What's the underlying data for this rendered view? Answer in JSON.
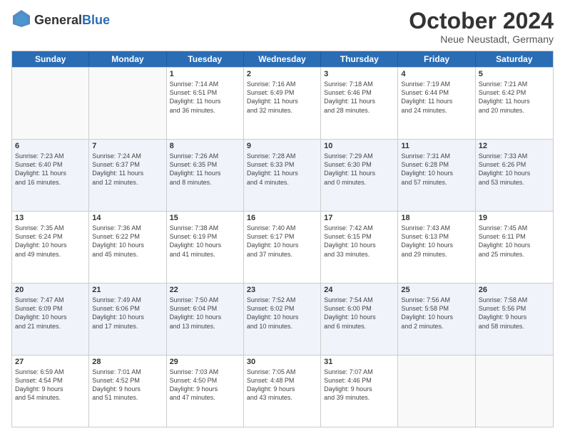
{
  "logo": {
    "general": "General",
    "blue": "Blue"
  },
  "title": "October 2024",
  "subtitle": "Neue Neustadt, Germany",
  "days": [
    "Sunday",
    "Monday",
    "Tuesday",
    "Wednesday",
    "Thursday",
    "Friday",
    "Saturday"
  ],
  "rows": [
    [
      {
        "day": "",
        "text": ""
      },
      {
        "day": "",
        "text": ""
      },
      {
        "day": "1",
        "text": "Sunrise: 7:14 AM\nSunset: 6:51 PM\nDaylight: 11 hours\nand 36 minutes."
      },
      {
        "day": "2",
        "text": "Sunrise: 7:16 AM\nSunset: 6:49 PM\nDaylight: 11 hours\nand 32 minutes."
      },
      {
        "day": "3",
        "text": "Sunrise: 7:18 AM\nSunset: 6:46 PM\nDaylight: 11 hours\nand 28 minutes."
      },
      {
        "day": "4",
        "text": "Sunrise: 7:19 AM\nSunset: 6:44 PM\nDaylight: 11 hours\nand 24 minutes."
      },
      {
        "day": "5",
        "text": "Sunrise: 7:21 AM\nSunset: 6:42 PM\nDaylight: 11 hours\nand 20 minutes."
      }
    ],
    [
      {
        "day": "6",
        "text": "Sunrise: 7:23 AM\nSunset: 6:40 PM\nDaylight: 11 hours\nand 16 minutes."
      },
      {
        "day": "7",
        "text": "Sunrise: 7:24 AM\nSunset: 6:37 PM\nDaylight: 11 hours\nand 12 minutes."
      },
      {
        "day": "8",
        "text": "Sunrise: 7:26 AM\nSunset: 6:35 PM\nDaylight: 11 hours\nand 8 minutes."
      },
      {
        "day": "9",
        "text": "Sunrise: 7:28 AM\nSunset: 6:33 PM\nDaylight: 11 hours\nand 4 minutes."
      },
      {
        "day": "10",
        "text": "Sunrise: 7:29 AM\nSunset: 6:30 PM\nDaylight: 11 hours\nand 0 minutes."
      },
      {
        "day": "11",
        "text": "Sunrise: 7:31 AM\nSunset: 6:28 PM\nDaylight: 10 hours\nand 57 minutes."
      },
      {
        "day": "12",
        "text": "Sunrise: 7:33 AM\nSunset: 6:26 PM\nDaylight: 10 hours\nand 53 minutes."
      }
    ],
    [
      {
        "day": "13",
        "text": "Sunrise: 7:35 AM\nSunset: 6:24 PM\nDaylight: 10 hours\nand 49 minutes."
      },
      {
        "day": "14",
        "text": "Sunrise: 7:36 AM\nSunset: 6:22 PM\nDaylight: 10 hours\nand 45 minutes."
      },
      {
        "day": "15",
        "text": "Sunrise: 7:38 AM\nSunset: 6:19 PM\nDaylight: 10 hours\nand 41 minutes."
      },
      {
        "day": "16",
        "text": "Sunrise: 7:40 AM\nSunset: 6:17 PM\nDaylight: 10 hours\nand 37 minutes."
      },
      {
        "day": "17",
        "text": "Sunrise: 7:42 AM\nSunset: 6:15 PM\nDaylight: 10 hours\nand 33 minutes."
      },
      {
        "day": "18",
        "text": "Sunrise: 7:43 AM\nSunset: 6:13 PM\nDaylight: 10 hours\nand 29 minutes."
      },
      {
        "day": "19",
        "text": "Sunrise: 7:45 AM\nSunset: 6:11 PM\nDaylight: 10 hours\nand 25 minutes."
      }
    ],
    [
      {
        "day": "20",
        "text": "Sunrise: 7:47 AM\nSunset: 6:09 PM\nDaylight: 10 hours\nand 21 minutes."
      },
      {
        "day": "21",
        "text": "Sunrise: 7:49 AM\nSunset: 6:06 PM\nDaylight: 10 hours\nand 17 minutes."
      },
      {
        "day": "22",
        "text": "Sunrise: 7:50 AM\nSunset: 6:04 PM\nDaylight: 10 hours\nand 13 minutes."
      },
      {
        "day": "23",
        "text": "Sunrise: 7:52 AM\nSunset: 6:02 PM\nDaylight: 10 hours\nand 10 minutes."
      },
      {
        "day": "24",
        "text": "Sunrise: 7:54 AM\nSunset: 6:00 PM\nDaylight: 10 hours\nand 6 minutes."
      },
      {
        "day": "25",
        "text": "Sunrise: 7:56 AM\nSunset: 5:58 PM\nDaylight: 10 hours\nand 2 minutes."
      },
      {
        "day": "26",
        "text": "Sunrise: 7:58 AM\nSunset: 5:56 PM\nDaylight: 9 hours\nand 58 minutes."
      }
    ],
    [
      {
        "day": "27",
        "text": "Sunrise: 6:59 AM\nSunset: 4:54 PM\nDaylight: 9 hours\nand 54 minutes."
      },
      {
        "day": "28",
        "text": "Sunrise: 7:01 AM\nSunset: 4:52 PM\nDaylight: 9 hours\nand 51 minutes."
      },
      {
        "day": "29",
        "text": "Sunrise: 7:03 AM\nSunset: 4:50 PM\nDaylight: 9 hours\nand 47 minutes."
      },
      {
        "day": "30",
        "text": "Sunrise: 7:05 AM\nSunset: 4:48 PM\nDaylight: 9 hours\nand 43 minutes."
      },
      {
        "day": "31",
        "text": "Sunrise: 7:07 AM\nSunset: 4:46 PM\nDaylight: 9 hours\nand 39 minutes."
      },
      {
        "day": "",
        "text": ""
      },
      {
        "day": "",
        "text": ""
      }
    ]
  ]
}
